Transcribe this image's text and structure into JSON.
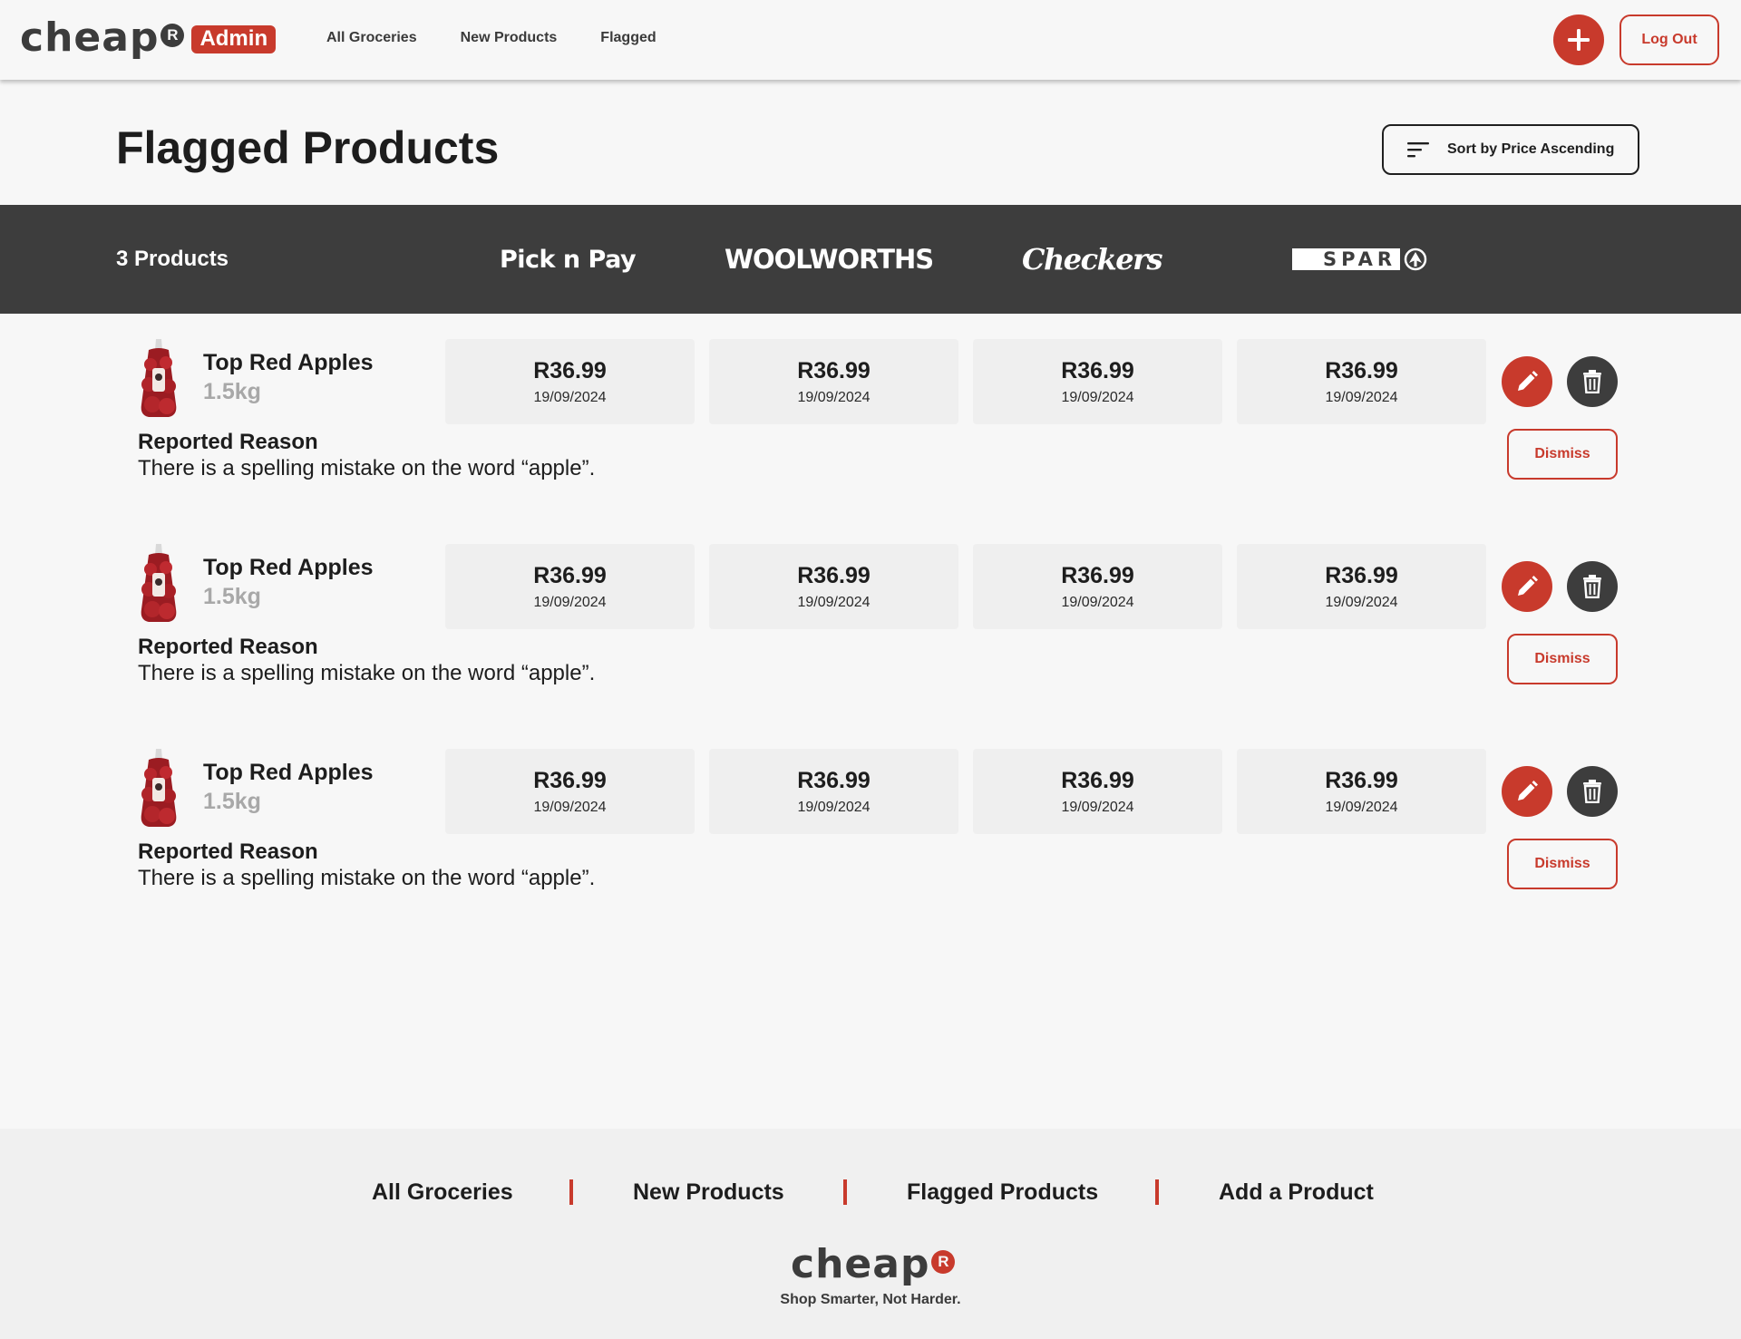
{
  "brand": {
    "name": "cheap",
    "mark": "R",
    "badge": "Admin"
  },
  "nav": {
    "links": [
      "All Groceries",
      "New Products",
      "Flagged"
    ],
    "add_icon": "plus-icon",
    "logout_label": "Log Out"
  },
  "page": {
    "title": "Flagged Products",
    "sort_label": "Sort by Price Ascending",
    "sort_icon": "sort-lines-icon"
  },
  "band": {
    "count_label": "3 Products",
    "stores": [
      "Pick n Pay",
      "WOOLWORTHS",
      "Checkers",
      "SPAR"
    ]
  },
  "products": [
    {
      "name": "Top Red Apples",
      "size": "1.5kg",
      "prices": [
        {
          "price": "R36.99",
          "date": "19/09/2024"
        },
        {
          "price": "R36.99",
          "date": "19/09/2024"
        },
        {
          "price": "R36.99",
          "date": "19/09/2024"
        },
        {
          "price": "R36.99",
          "date": "19/09/2024"
        }
      ],
      "reason_title": "Reported Reason",
      "reason_text": "There is a spelling mistake on the word “apple”.",
      "dismiss_label": "Dismiss"
    },
    {
      "name": "Top Red Apples",
      "size": "1.5kg",
      "prices": [
        {
          "price": "R36.99",
          "date": "19/09/2024"
        },
        {
          "price": "R36.99",
          "date": "19/09/2024"
        },
        {
          "price": "R36.99",
          "date": "19/09/2024"
        },
        {
          "price": "R36.99",
          "date": "19/09/2024"
        }
      ],
      "reason_title": "Reported Reason",
      "reason_text": "There is a spelling mistake on the word “apple”.",
      "dismiss_label": "Dismiss"
    },
    {
      "name": "Top Red Apples",
      "size": "1.5kg",
      "prices": [
        {
          "price": "R36.99",
          "date": "19/09/2024"
        },
        {
          "price": "R36.99",
          "date": "19/09/2024"
        },
        {
          "price": "R36.99",
          "date": "19/09/2024"
        },
        {
          "price": "R36.99",
          "date": "19/09/2024"
        }
      ],
      "reason_title": "Reported Reason",
      "reason_text": "There is a spelling mistake on the word “apple”.",
      "dismiss_label": "Dismiss"
    }
  ],
  "footer": {
    "links": [
      "All Groceries",
      "New Products",
      "Flagged Products",
      "Add a Product"
    ],
    "tagline": "Shop Smarter, Not Harder."
  },
  "colors": {
    "accent": "#c83a2c",
    "dark": "#3d3d3d",
    "background": "#f7f7f7",
    "card": "#efefef",
    "muted": "#a8a8a8"
  }
}
